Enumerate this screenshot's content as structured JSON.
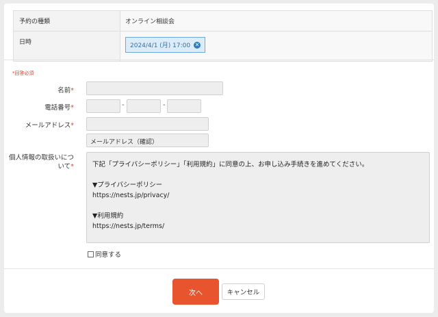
{
  "summary": {
    "type_label": "予約の種類",
    "type_value": "オンライン相談会",
    "datetime_label": "日時",
    "datetime_value": "2024/4/1 (月) 17:00"
  },
  "form": {
    "required_note": "*回答必須",
    "name_label": "名前",
    "phone_label": "電話番号",
    "phone_separator": "-",
    "email_label": "メールアドレス",
    "email_confirm_placeholder": "メールアドレス（確認）",
    "privacy_label": "個人情報の取扱いについて",
    "required_mark": "*",
    "policy_text": {
      "intro": "下記「プライバシーポリシー」「利用規約」に同意の上、お申し込み手続きを進めてください。",
      "privacy_heading": "▼プライバシーポリシー",
      "privacy_url": "https://nests.jp/privacy/",
      "terms_heading": "▼利用規約",
      "terms_url": "https://nests.jp/terms/"
    },
    "agree_label": "同意する",
    "agree_checked": false
  },
  "actions": {
    "next_label": "次へ",
    "cancel_label": "キャンセル"
  },
  "colors": {
    "accent": "#e8542e",
    "required": "#d9452c",
    "chip_border": "#6aa9d8",
    "chip_bg": "#dcecf8"
  }
}
